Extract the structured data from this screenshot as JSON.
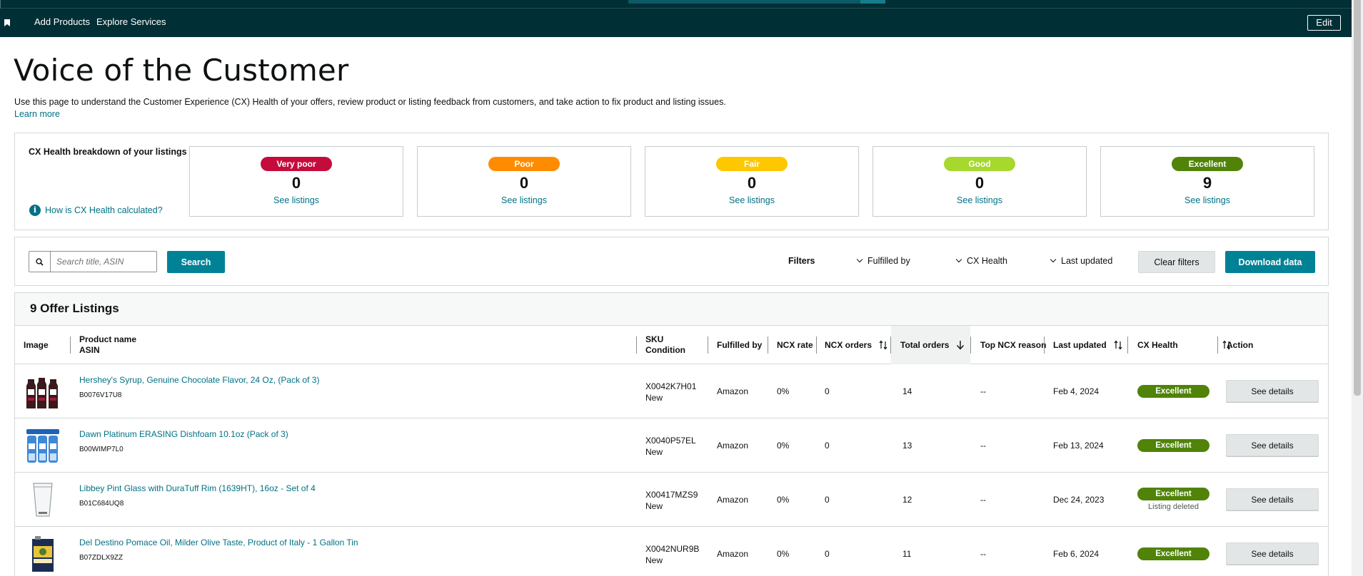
{
  "nav": {
    "items": [
      "Add Products",
      "Explore Services"
    ],
    "edit_label": "Edit"
  },
  "page": {
    "title": "Voice of the Customer",
    "description": "Use this page to understand the Customer Experience (CX) Health of your offers, review product or listing feedback from customers, and take action to fix product and listing issues.",
    "learn_more": "Learn more"
  },
  "health": {
    "title": "CX Health breakdown of your listings",
    "calc_link": "How is CX Health calculated?",
    "see_listings": "See listings",
    "cards": [
      {
        "label": "Very poor",
        "count": "0",
        "color": "#c40c3c",
        "text_color": "#ffffff"
      },
      {
        "label": "Poor",
        "count": "0",
        "color": "#ff8c00",
        "text_color": "#ffffff"
      },
      {
        "label": "Fair",
        "count": "0",
        "color": "#fec700",
        "text_color": "#ffffff"
      },
      {
        "label": "Good",
        "count": "0",
        "color": "#a6d82e",
        "text_color": "#ffffff"
      },
      {
        "label": "Excellent",
        "count": "9",
        "color": "#508308",
        "text_color": "#ffffff"
      }
    ]
  },
  "filters": {
    "search_placeholder": "Search title, ASIN",
    "search_label": "Search",
    "filters_label": "Filters",
    "dropdowns": [
      "Fulfilled by",
      "CX Health",
      "Last updated"
    ],
    "clear_label": "Clear filters",
    "download_label": "Download data"
  },
  "listings": {
    "title": "9 Offer Listings",
    "headers": {
      "image": "Image",
      "product_name": "Product name",
      "asin": "ASIN",
      "sku": "SKU",
      "condition": "Condition",
      "fulfilled_by": "Fulfilled by",
      "ncx_rate": "NCX rate",
      "ncx_orders": "NCX orders",
      "total_orders": "Total orders",
      "top_ncx_reason": "Top NCX reason",
      "last_updated": "Last updated",
      "cx_health": "CX Health",
      "action": "Action"
    },
    "action_label": "See details",
    "rows": [
      {
        "name": "Hershey's Syrup, Genuine Chocolate Flavor, 24 Oz, (Pack of 3)",
        "asin": "B0076V17U8",
        "sku": "X0042K7H01",
        "condition": "New",
        "fulfilled_by": "Amazon",
        "ncx_rate": "0%",
        "ncx_orders": "0",
        "total_orders": "14",
        "top_ncx_reason": "--",
        "last_updated": "Feb 4, 2024",
        "cx_health": "Excellent",
        "note": ""
      },
      {
        "name": "Dawn Platinum ERASING Dishfoam 10.1oz (Pack of 3)",
        "asin": "B00WIMP7L0",
        "sku": "X0040P57EL",
        "condition": "New",
        "fulfilled_by": "Amazon",
        "ncx_rate": "0%",
        "ncx_orders": "0",
        "total_orders": "13",
        "top_ncx_reason": "--",
        "last_updated": "Feb 13, 2024",
        "cx_health": "Excellent",
        "note": ""
      },
      {
        "name": "Libbey Pint Glass with DuraTuff Rim (1639HT), 16oz - Set of 4",
        "asin": "B01C684UQ8",
        "sku": "X00417MZS9",
        "condition": "New",
        "fulfilled_by": "Amazon",
        "ncx_rate": "0%",
        "ncx_orders": "0",
        "total_orders": "12",
        "top_ncx_reason": "--",
        "last_updated": "Dec 24, 2023",
        "cx_health": "Excellent",
        "note": "Listing deleted"
      },
      {
        "name": "Del Destino Pomace Oil, Milder Olive Taste, Product of Italy - 1 Gallon Tin",
        "asin": "B07ZDLX9ZZ",
        "sku": "X0042NUR9B",
        "condition": "New",
        "fulfilled_by": "Amazon",
        "ncx_rate": "0%",
        "ncx_orders": "0",
        "total_orders": "11",
        "top_ncx_reason": "--",
        "last_updated": "Feb 6, 2024",
        "cx_health": "Excellent",
        "note": ""
      }
    ]
  },
  "icons": {
    "bookmark": "bookmark-icon",
    "search": "search-icon",
    "info": "info-icon",
    "sort": "sort-icon",
    "sort_desc": "arrow-down-icon",
    "dropdown": "chevron-down-icon"
  }
}
